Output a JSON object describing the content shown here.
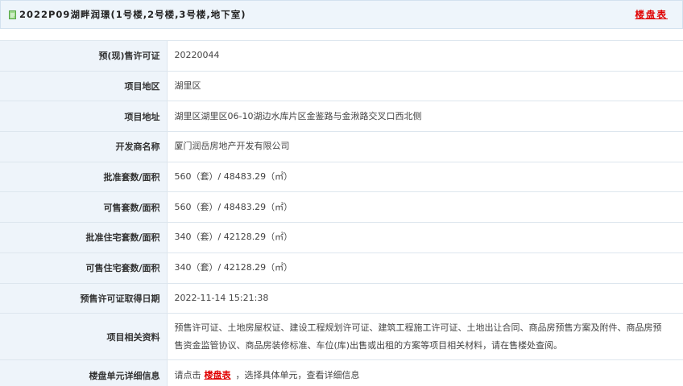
{
  "header": {
    "title": "2022P09湖畔润璟(1号楼,2号楼,3号楼,地下室)",
    "table_link": "楼盘表"
  },
  "rows": [
    {
      "label": "预(现)售许可证",
      "value": "20220044"
    },
    {
      "label": "项目地区",
      "value": "湖里区"
    },
    {
      "label": "项目地址",
      "value": "湖里区湖里区06-10湖边水库片区金鉴路与金湫路交叉口西北侧"
    },
    {
      "label": "开发商名称",
      "value": "厦门润岳房地产开发有限公司"
    },
    {
      "label": "批准套数/面积",
      "value": "560（套）/ 48483.29（㎡）"
    },
    {
      "label": "可售套数/面积",
      "value": "560（套）/ 48483.29（㎡）"
    },
    {
      "label": "批准住宅套数/面积",
      "value": "340（套）/ 42128.29（㎡）"
    },
    {
      "label": "可售住宅套数/面积",
      "value": "340（套）/ 42128.29（㎡）"
    },
    {
      "label": "预售许可证取得日期",
      "value": "2022-11-14 15:21:38"
    },
    {
      "label": "项目相关资料",
      "value": "预售许可证、土地房屋权证、建设工程规划许可证、建筑工程施工许可证、土地出让合同、商品房预售方案及附件、商品房预售资金监管协议、商品房装修标准、车位(库)出售或出租的方案等项目相关材料，请在售楼处查阅。"
    },
    {
      "label": "楼盘单元详细信息",
      "value_prefix": "请点击",
      "value_link": "楼盘表",
      "value_suffix": "，选择具体单元，查看详细信息"
    }
  ],
  "colors": {
    "header_bg": "#eef5fb",
    "label_bg": "#eef4fa",
    "link": "#e00000",
    "border": "#dde6ee"
  }
}
